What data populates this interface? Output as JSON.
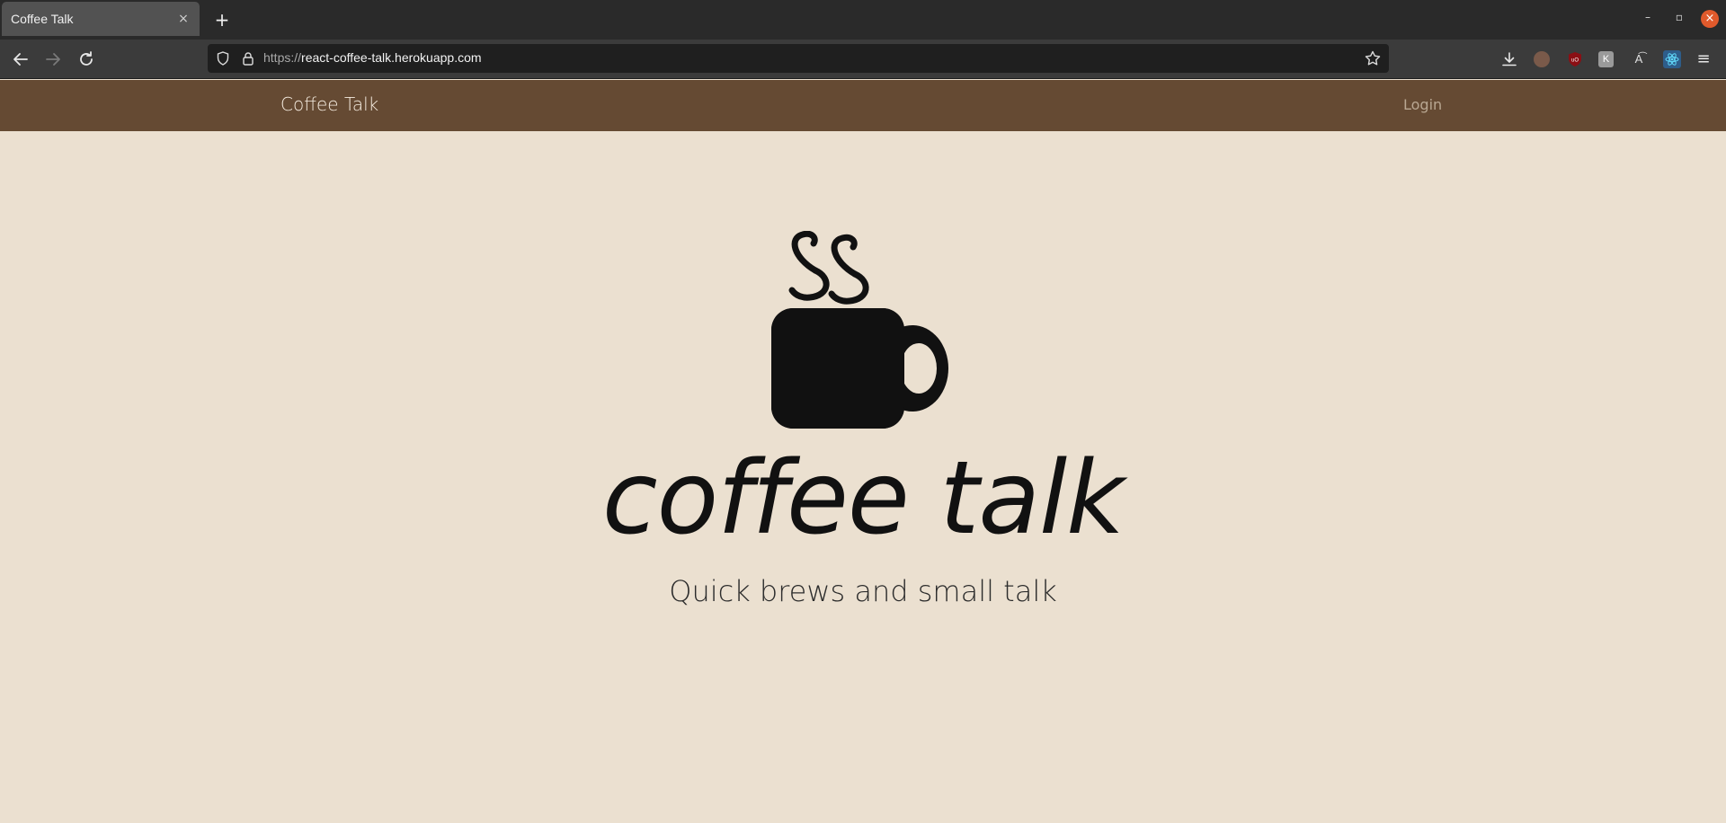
{
  "browser": {
    "tab_title": "Coffee Talk",
    "tab_close": "×",
    "new_tab": "+",
    "window_min": "–",
    "window_max": "▫",
    "window_close": "×",
    "url_scheme": "https://",
    "url_host": "react-coffee-talk.herokuapp.com",
    "toolbar_k": "K",
    "toolbar_translate": "A͡",
    "menu": "≡"
  },
  "header": {
    "brand": "Coffee Talk",
    "login": "Login",
    "background": "#654a33"
  },
  "hero": {
    "wordmark": "coffee talk",
    "tagline": "Quick brews and small talk",
    "logo_icon": "coffee-cup-icon"
  },
  "colors": {
    "page_background": "#ebe0d0",
    "logo": "#111111"
  }
}
